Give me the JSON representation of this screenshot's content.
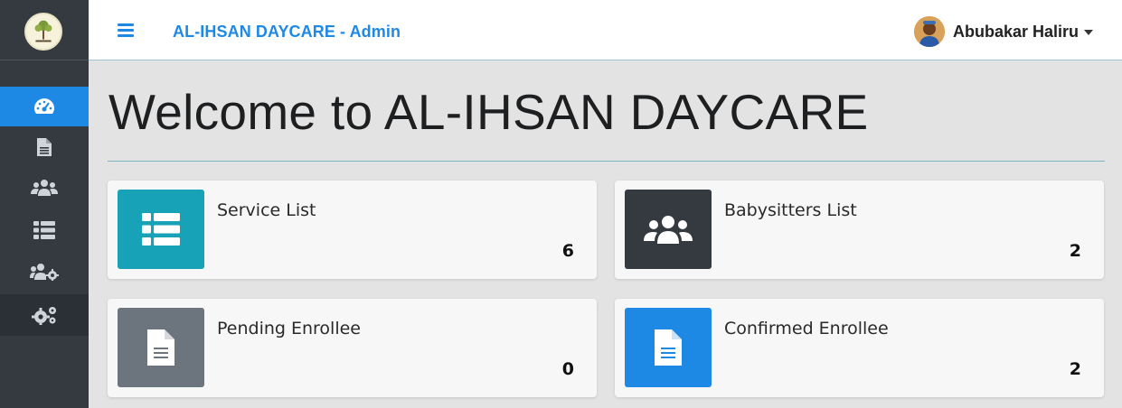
{
  "header": {
    "brand": "AL-IHSAN DAYCARE - Admin",
    "user_name": "Abubakar Haliru"
  },
  "sidebar": {
    "items": [
      {
        "icon": "tachometer-icon",
        "active": true
      },
      {
        "icon": "file-icon"
      },
      {
        "icon": "users-icon"
      },
      {
        "icon": "list-icon"
      },
      {
        "icon": "users-cog-icon"
      },
      {
        "icon": "cogs-icon"
      }
    ]
  },
  "main": {
    "title": "Welcome to AL-IHSAN DAYCARE",
    "cards": [
      {
        "label": "Service List",
        "count": "6",
        "icon": "list-icon",
        "color": "#17a2b8"
      },
      {
        "label": "Babysitters List",
        "count": "2",
        "icon": "users-icon",
        "color": "#343a40"
      },
      {
        "label": "Pending Enrollee",
        "count": "0",
        "icon": "file-icon",
        "color": "#6c757d"
      },
      {
        "label": "Confirmed Enrollee",
        "count": "2",
        "icon": "file-icon",
        "color": "#1e88e5"
      }
    ]
  },
  "colors": {
    "accent": "#1e88e5",
    "sidebar": "#343a40"
  }
}
